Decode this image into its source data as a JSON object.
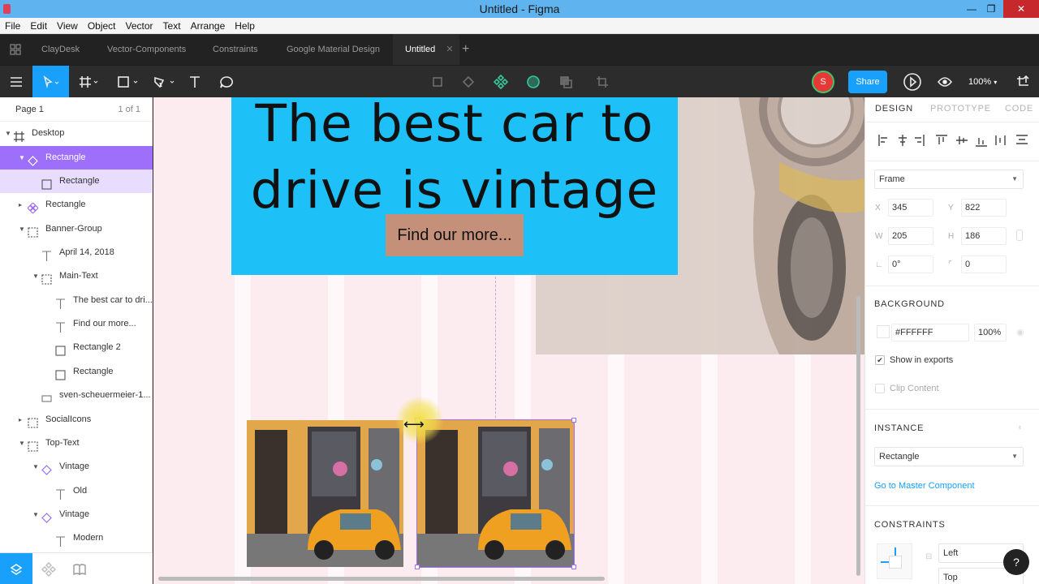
{
  "window": {
    "title": "Untitled - Figma",
    "minimize": "—",
    "maximize": "❐",
    "close": "✕"
  },
  "menu": [
    "File",
    "Edit",
    "View",
    "Object",
    "Vector",
    "Text",
    "Arrange",
    "Help"
  ],
  "tabs": [
    {
      "label": "ClayDesk"
    },
    {
      "label": "Vector-Components"
    },
    {
      "label": "Constraints"
    },
    {
      "label": "Google Material Design"
    },
    {
      "label": "Untitled",
      "active": true
    }
  ],
  "toolbar": {
    "avatar_initial": "S",
    "share_label": "Share",
    "zoom": "100%"
  },
  "layers": {
    "page_name": "Page 1",
    "page_count": "1 of 1",
    "items": [
      {
        "label": "Desktop",
        "icon": "frame-icon"
      },
      {
        "label": "Rectangle",
        "icon": "component-instance-icon"
      },
      {
        "label": "Rectangle",
        "icon": "rectangle-icon"
      },
      {
        "label": "Rectangle",
        "icon": "component-icon"
      },
      {
        "label": "Banner-Group",
        "icon": "group-icon"
      },
      {
        "label": "April 14, 2018",
        "icon": "text-icon"
      },
      {
        "label": "Main-Text",
        "icon": "group-icon"
      },
      {
        "label": "The best car to dri...",
        "icon": "text-icon"
      },
      {
        "label": "Find our more...",
        "icon": "text-icon"
      },
      {
        "label": "Rectangle 2",
        "icon": "rectangle-icon"
      },
      {
        "label": "Rectangle",
        "icon": "rectangle-icon"
      },
      {
        "label": "sven-scheuermeier-1...",
        "icon": "image-icon"
      },
      {
        "label": "SocialIcons",
        "icon": "group-icon"
      },
      {
        "label": "Top-Text",
        "icon": "group-icon"
      },
      {
        "label": "Vintage",
        "icon": "component-instance-icon"
      },
      {
        "label": "Old",
        "icon": "text-icon"
      },
      {
        "label": "Vintage",
        "icon": "component-instance-icon"
      },
      {
        "label": "Modern",
        "icon": "text-icon"
      }
    ]
  },
  "canvas": {
    "headline": "The best car to drive is vintage",
    "cta": "Find our more..."
  },
  "props": {
    "tabs": [
      "DESIGN",
      "PROTOTYPE",
      "CODE"
    ],
    "frame_select": "Frame",
    "x_label": "X",
    "x": "345",
    "y_label": "Y",
    "y": "822",
    "w_label": "W",
    "w": "205",
    "h_label": "H",
    "h": "186",
    "rotation": "0°",
    "radius": "0",
    "background_header": "BACKGROUND",
    "bg_hex": "#FFFFFF",
    "bg_opacity": "100%",
    "show_exports": "Show in exports",
    "clip_content": "Clip Content",
    "instance_header": "INSTANCE",
    "instance_select": "Rectangle",
    "master_link": "Go to Master Component",
    "constraints_header": "CONSTRAINTS",
    "constraint_h": "Left",
    "constraint_v": "Top"
  },
  "colors": {
    "accent": "#18a0fb",
    "selection": "#9d6ffb",
    "banner": "#1ec1f7",
    "cta": "#c4907a",
    "car": "#f0a020"
  }
}
